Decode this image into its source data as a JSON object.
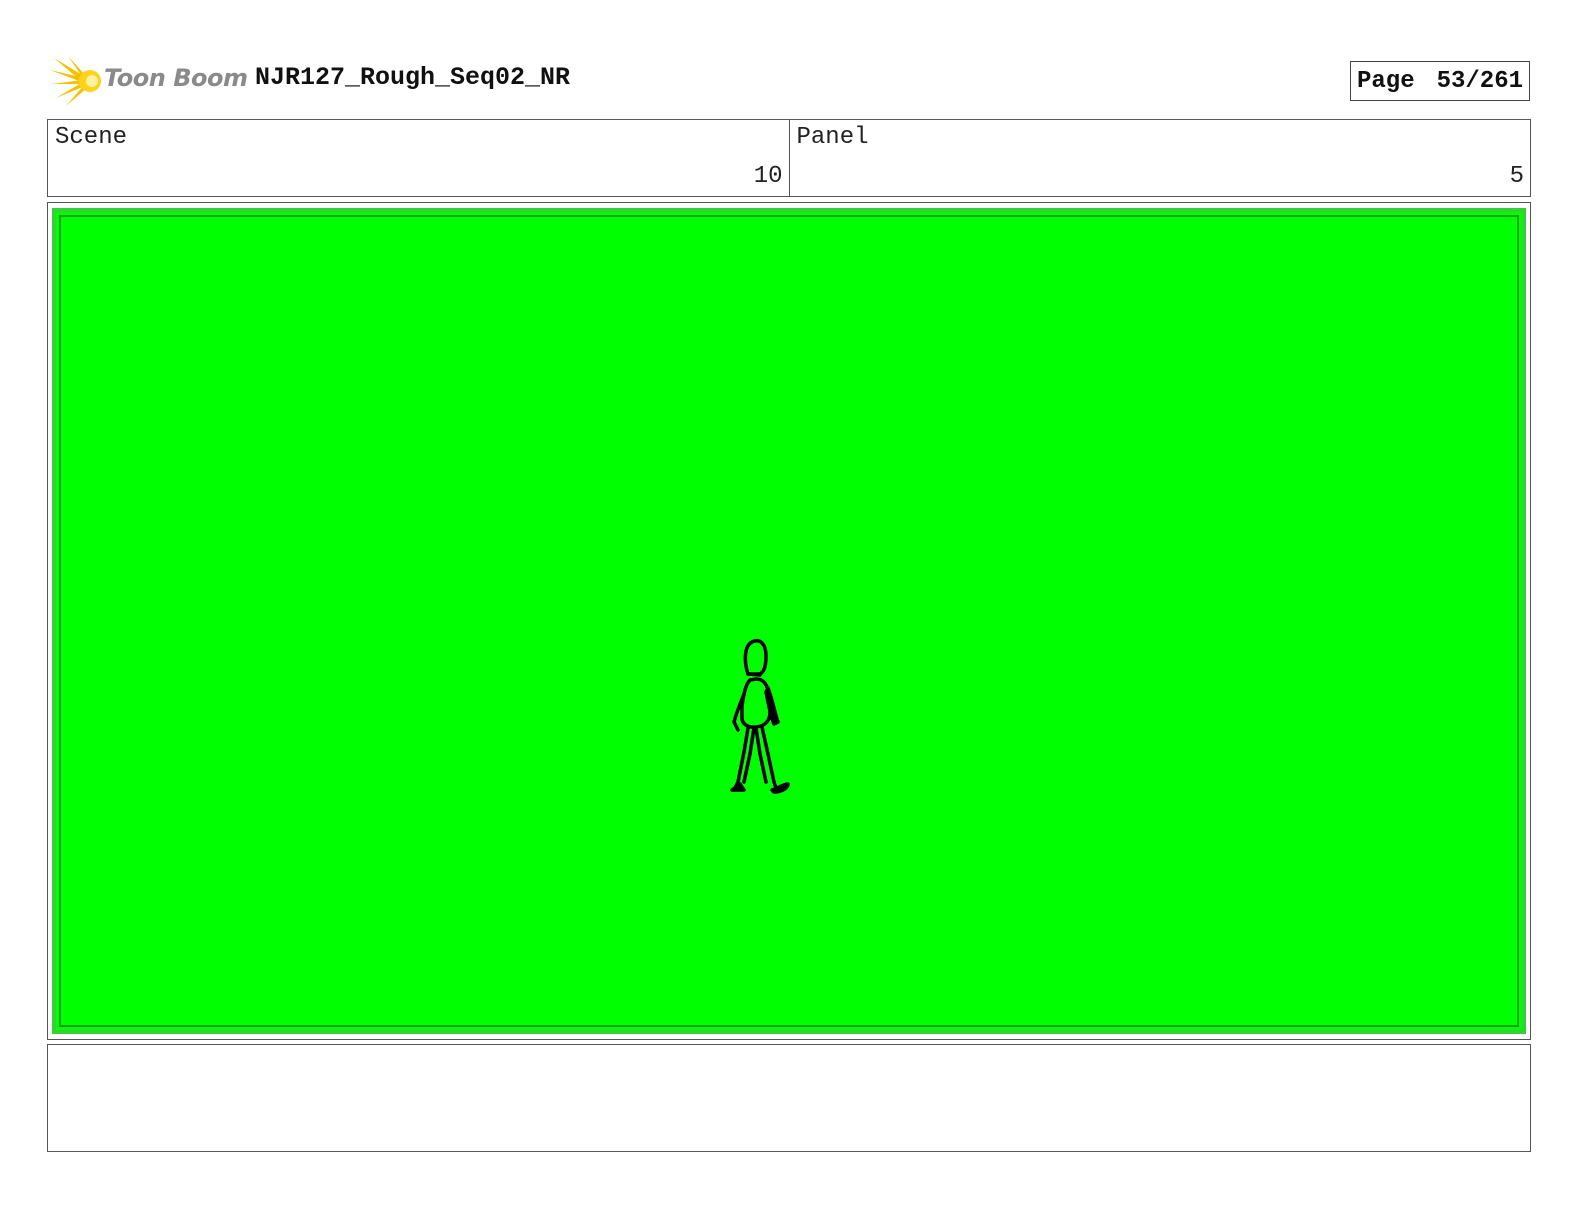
{
  "header": {
    "logo_text": "Toon Boom",
    "document_title": "NJR127_Rough_Seq02_NR",
    "page_label": "Page",
    "page_value": "53/261"
  },
  "info": {
    "scene_label": "Scene",
    "scene_value": "10",
    "panel_label": "Panel",
    "panel_value": "5"
  },
  "panel": {
    "background_color": "#00ff00",
    "drawing": "walking-figure-sketch"
  },
  "notes": {
    "text": ""
  },
  "colors": {
    "logo_flare": "#f5c000",
    "logo_text": "#8a8a8a"
  }
}
